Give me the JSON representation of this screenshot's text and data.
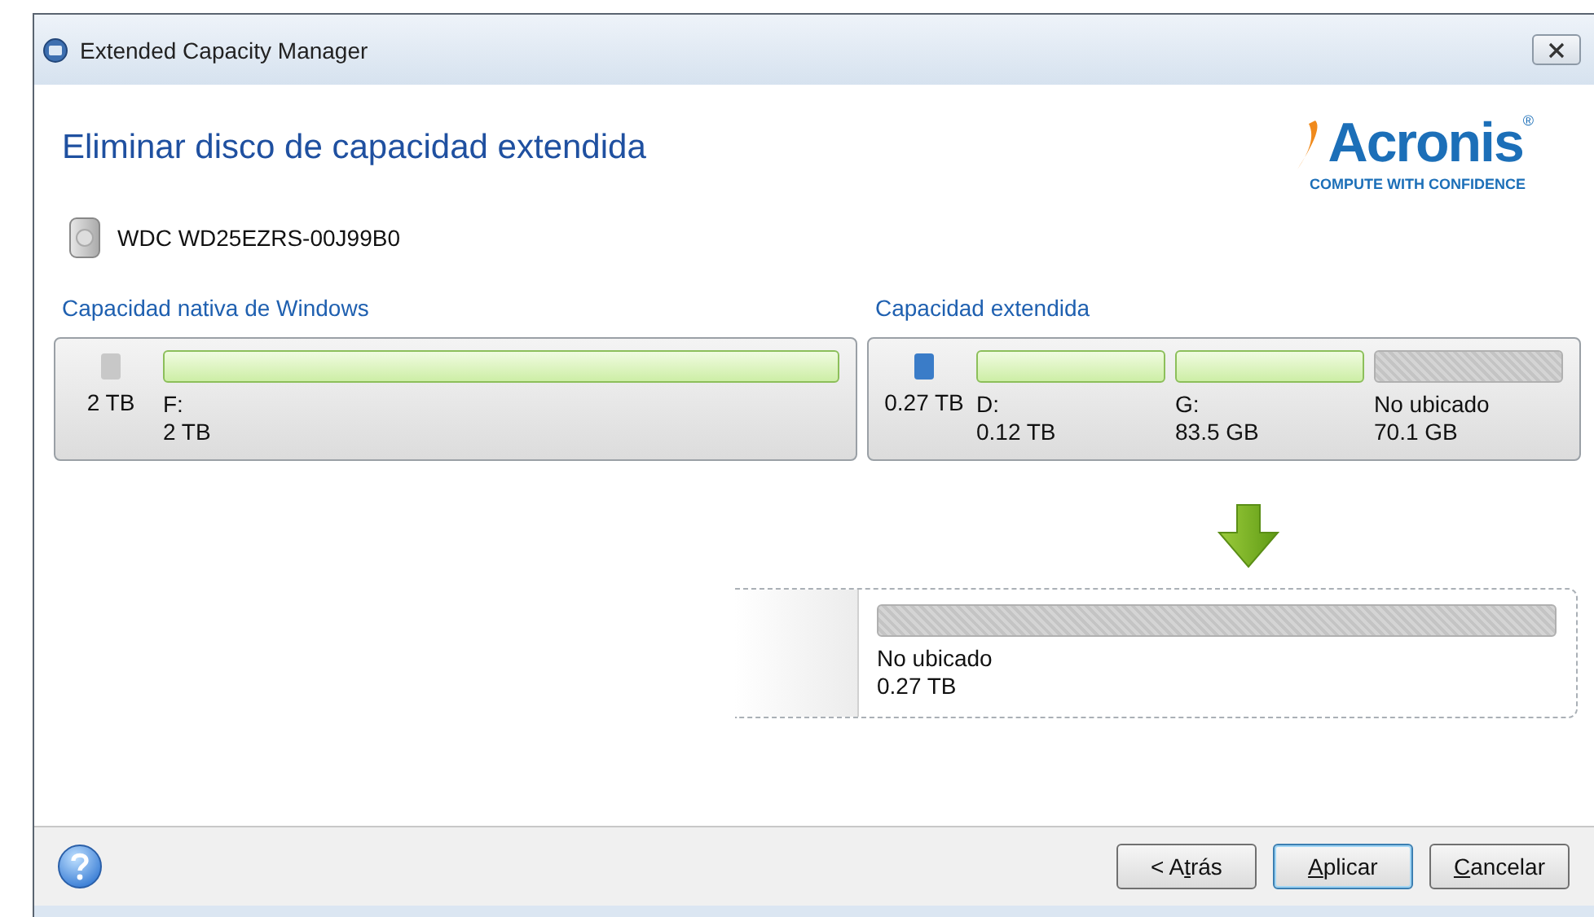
{
  "window": {
    "title": "Extended Capacity Manager"
  },
  "heading": "Eliminar disco de capacidad extendida",
  "logo": {
    "name": "Acronis$^{®}$",
    "tagline": "COMPUTE WITH CONFIDENCE"
  },
  "disk": {
    "name": "WDC WD25EZRS-00J99B0"
  },
  "sections": [
    {
      "title": "Capacidad nativa de Windows",
      "color": "#c8c8c8",
      "size": "2 TB",
      "partitions": [
        {
          "kind": "used",
          "label": "F:",
          "size": "2 TB"
        }
      ]
    },
    {
      "title": "Capacidad extendida",
      "color": "#3a7cc8",
      "size": "0.27 TB",
      "partitions": [
        {
          "kind": "used",
          "label": "D:",
          "size": "0.12 TB"
        },
        {
          "kind": "used",
          "label": "G:",
          "size": "83.5 GB"
        },
        {
          "kind": "unallocated",
          "label": "No ubicado",
          "size": "70.1 GB"
        }
      ]
    }
  ],
  "result": {
    "partitions": [
      {
        "kind": "unallocated",
        "label": "No ubicado",
        "size": "0.27 TB"
      }
    ]
  },
  "buttons": [
    {
      "label": "< Atrás",
      "default": false
    },
    {
      "label": "Aplicar",
      "default": true
    },
    {
      "label": "Cancelar",
      "default": false
    }
  ]
}
